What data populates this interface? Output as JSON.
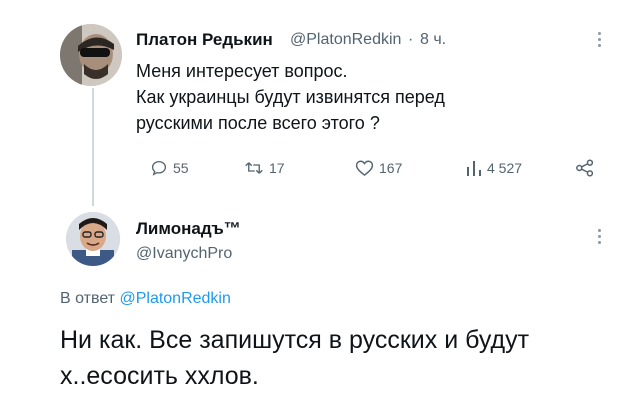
{
  "tweet": {
    "author_name": "Платон Редькин",
    "author_handle": "@PlatonRedkin",
    "separator": "·",
    "time": "8 ч.",
    "lines": [
      "Меня интересует вопрос.",
      "Как украинцы будут извинятся перед",
      "русскими после всего этого ?"
    ],
    "actions": {
      "replies": "55",
      "retweets": "17",
      "likes": "167",
      "views": "4 527"
    }
  },
  "reply": {
    "author_name": "Лимонадъ™",
    "author_handle": "@IvanychPro",
    "reply_to_prefix": "В ответ",
    "reply_to_handle": "@PlatonRedkin",
    "text": "Ни как. Все запишутся в русских и будут х..есосить ххлов."
  },
  "icons": {
    "reply": "reply-icon",
    "retweet": "retweet-icon",
    "like": "heart-icon",
    "views": "views-icon",
    "share": "share-icon",
    "more": "more-icon"
  },
  "colors": {
    "text": "#0f1419",
    "secondary": "#536471",
    "link": "#1d9bf0",
    "thread_line": "#cfd9de"
  }
}
